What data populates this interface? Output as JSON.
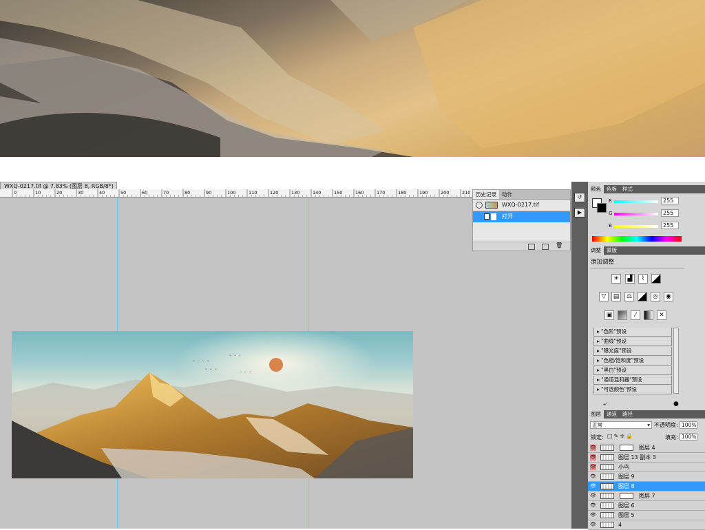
{
  "document_tab": {
    "title": "WXQ-0217.tif @ 7.83% (图层 8, RGB/8*)"
  },
  "ruler": {
    "ticks": [
      "0",
      "10",
      "20",
      "30",
      "40",
      "50",
      "60",
      "70",
      "80",
      "90",
      "100",
      "110",
      "120",
      "130",
      "140",
      "150",
      "160",
      "170",
      "180",
      "190",
      "200",
      "210"
    ]
  },
  "history_panel": {
    "tabs": [
      {
        "label": "历史记录"
      },
      {
        "label": "动作"
      }
    ],
    "snapshot_label": "WXQ-0217.tif",
    "steps": [
      {
        "label": "打开",
        "selected": true
      }
    ]
  },
  "color_panel": {
    "tabs": [
      {
        "label": "颜色"
      },
      {
        "label": "色板"
      },
      {
        "label": "样式"
      }
    ],
    "channels": [
      {
        "name": "R",
        "value": "255"
      },
      {
        "name": "G",
        "value": "255"
      },
      {
        "name": "B",
        "value": "255"
      }
    ]
  },
  "adjustments_panel": {
    "tabs": [
      {
        "label": "调整"
      },
      {
        "label": "蒙版"
      }
    ],
    "heading": "添加调整",
    "presets": [
      "\"色阶\"预设",
      "\"曲线\"预设",
      "\"曝光度\"预设",
      "\"色相/饱和度\"预设",
      "\"黑白\"预设",
      "\"通道混和器\"预设",
      "\"可选颜色\"预设"
    ]
  },
  "layers_panel": {
    "tabs": [
      {
        "label": "图层"
      },
      {
        "label": "通道"
      },
      {
        "label": "路径"
      }
    ],
    "blend_mode": "正常",
    "opacity_label": "不透明度:",
    "opacity_value": "100%",
    "lock_label": "锁定:",
    "fill_label": "填充:",
    "fill_value": "100%",
    "layers": [
      {
        "name": "图层 4",
        "mask": true,
        "selected": false
      },
      {
        "name": "图层 13 副本 3",
        "mask": false,
        "selected": false
      },
      {
        "name": "小鸟",
        "mask": false,
        "selected": false
      },
      {
        "name": "图层 9",
        "mask": false,
        "selected": false
      },
      {
        "name": "图层 8",
        "mask": false,
        "selected": true
      },
      {
        "name": "图层 7",
        "mask": true,
        "selected": false
      },
      {
        "name": "图层 6",
        "mask": false,
        "selected": false
      },
      {
        "name": "图层 5",
        "mask": false,
        "selected": false
      },
      {
        "name": "4",
        "mask": false,
        "selected": false
      }
    ]
  },
  "colors": {
    "selection": "#3399ff",
    "guide": "#3fd9e8",
    "workspace": "#c3c3c3",
    "panel_dark": "#5a5a5a"
  }
}
